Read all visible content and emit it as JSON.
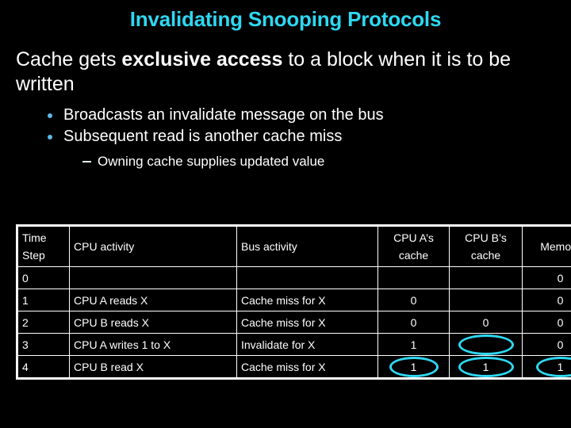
{
  "slide": {
    "title": "Invalidating Snooping Protocols",
    "lead": {
      "before": "Cache gets ",
      "emphasis": "exclusive access",
      "after": " to a block when it is to be",
      "line2": "written"
    },
    "bullets": [
      "Broadcasts an invalidate message on the bus",
      "Subsequent read is another cache miss"
    ],
    "subbullets": [
      "Owning cache supplies updated value"
    ]
  },
  "colors": {
    "background": "#000000",
    "title": "#2ed8f2",
    "body_text": "#ffffff",
    "bullet_dot": "#5fb9ea",
    "highlight_ellipse": "#2ed8f2",
    "table_border": "#ffffff"
  },
  "table": {
    "headers": {
      "time_step_line1": "Time",
      "time_step_line2": "Step",
      "cpu_activity": "CPU activity",
      "bus_activity": "Bus activity",
      "cpu_a_line1": "CPU A’s",
      "cpu_a_line2": "cache",
      "cpu_b_line1": "CPU B’s",
      "cpu_b_line2": "cache",
      "memory": "Memory"
    },
    "rows": [
      {
        "time_step": "0",
        "cpu_activity": "",
        "bus_activity": "",
        "cpu_a_cache": "",
        "cpu_b_cache": "",
        "memory": "0",
        "highlight": []
      },
      {
        "time_step": "1",
        "cpu_activity": "CPU A reads X",
        "bus_activity": "Cache miss for X",
        "cpu_a_cache": "0",
        "cpu_b_cache": "",
        "memory": "0",
        "highlight": []
      },
      {
        "time_step": "2",
        "cpu_activity": "CPU B reads X",
        "bus_activity": "Cache miss for X",
        "cpu_a_cache": "0",
        "cpu_b_cache": "0",
        "memory": "0",
        "highlight": []
      },
      {
        "time_step": "3",
        "cpu_activity": "CPU A writes 1 to X",
        "bus_activity": "Invalidate for X",
        "cpu_a_cache": "1",
        "cpu_b_cache": "",
        "memory": "0",
        "highlight": [
          "cpu_b_cache"
        ]
      },
      {
        "time_step": "4",
        "cpu_activity": "CPU B read X",
        "bus_activity": "Cache miss for X",
        "cpu_a_cache": "1",
        "cpu_b_cache": "1",
        "memory": "1",
        "highlight": [
          "cpu_a_cache",
          "cpu_b_cache",
          "memory"
        ]
      }
    ]
  }
}
